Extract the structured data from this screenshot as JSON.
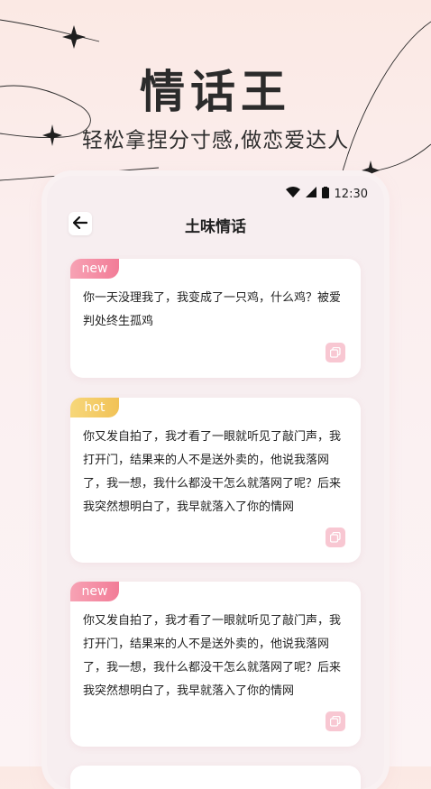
{
  "hero": {
    "title": "情话王",
    "subtitle": "轻松拿捏分寸感,做恋爱达人"
  },
  "status_bar": {
    "time": "12:30",
    "icons": [
      "wifi-icon",
      "signal-icon",
      "battery-icon"
    ]
  },
  "nav": {
    "back_icon": "arrow-left-icon",
    "title": "土味情话"
  },
  "cards": [
    {
      "tag": "new",
      "text": "你一天没理我了，我变成了一只鸡，什么鸡？被爱判处终生孤鸡",
      "action_icon": "copy-icon"
    },
    {
      "tag": "hot",
      "text": "你又发自拍了，我才看了一眼就听见了敲门声，我打开门，结果来的人不是送外卖的，他说我落网了，我一想，我什么都没干怎么就落网了呢？后来我突然想明白了，我早就落入了你的情网",
      "action_icon": "copy-icon"
    },
    {
      "tag": "new",
      "text": "你又发自拍了，我才看了一眼就听见了敲门声，我打开门，结果来的人不是送外卖的，他说我落网了，我一想，我什么都没干怎么就落网了呢？后来我突然想明白了，我早就落入了你的情网",
      "action_icon": "copy-icon"
    }
  ],
  "colors": {
    "tag_new": "#f27c97",
    "tag_hot": "#f1c257",
    "copy_button": "#f8c7d2",
    "background": "#fbeeee"
  }
}
